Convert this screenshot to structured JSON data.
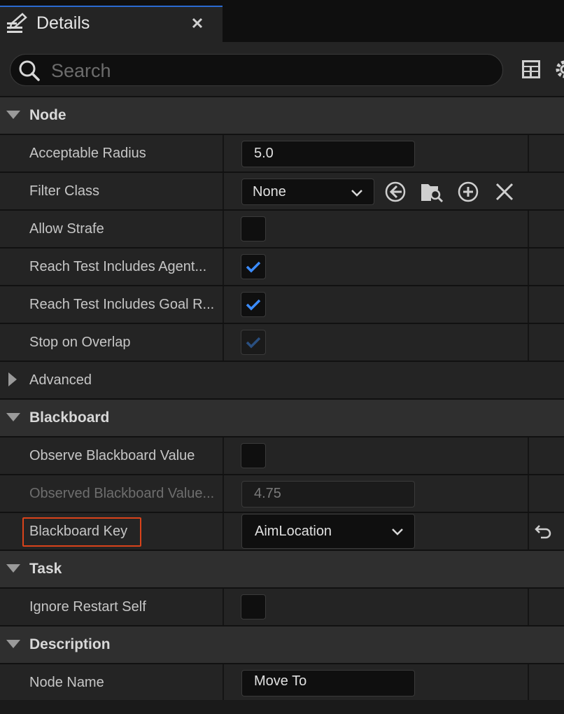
{
  "tab": {
    "title": "Details",
    "icon": "edit-icon",
    "close_icon": "close-icon"
  },
  "search": {
    "placeholder": "Search",
    "value": ""
  },
  "toolbar": {
    "grid_icon": "grid-view-icon",
    "settings_icon": "gear-icon"
  },
  "categories": {
    "node": "Node",
    "advanced": "Advanced",
    "blackboard": "Blackboard",
    "task": "Task",
    "description": "Description"
  },
  "node": {
    "acceptable_radius": {
      "label": "Acceptable Radius",
      "value": "5.0"
    },
    "filter_class": {
      "label": "Filter Class",
      "value": "None",
      "tools": [
        "browse-back-icon",
        "find-in-browser-icon",
        "add-icon",
        "clear-icon"
      ]
    },
    "allow_strafe": {
      "label": "Allow Strafe",
      "checked": false
    },
    "reach_agent": {
      "label": "Reach Test Includes Agent...",
      "checked": true
    },
    "reach_goal": {
      "label": "Reach Test Includes Goal R...",
      "checked": true
    },
    "stop_on_overlap": {
      "label": "Stop on Overlap",
      "checked": true,
      "enabled": false
    }
  },
  "blackboard": {
    "observe": {
      "label": "Observe Blackboard Value",
      "checked": false
    },
    "observed_tolerance": {
      "label": "Observed Blackboard Value...",
      "value": "4.75",
      "enabled": false
    },
    "key": {
      "label": "Blackboard Key",
      "value": "AimLocation",
      "reset_icon": "reset-to-default-icon"
    }
  },
  "task": {
    "ignore_restart_self": {
      "label": "Ignore Restart Self",
      "checked": false
    }
  },
  "description": {
    "node_name": {
      "label": "Node Name",
      "value": "Move To"
    }
  },
  "colors": {
    "accent": "#2b6ad1",
    "check": "#3b8cff",
    "highlight": "#d9431a"
  }
}
